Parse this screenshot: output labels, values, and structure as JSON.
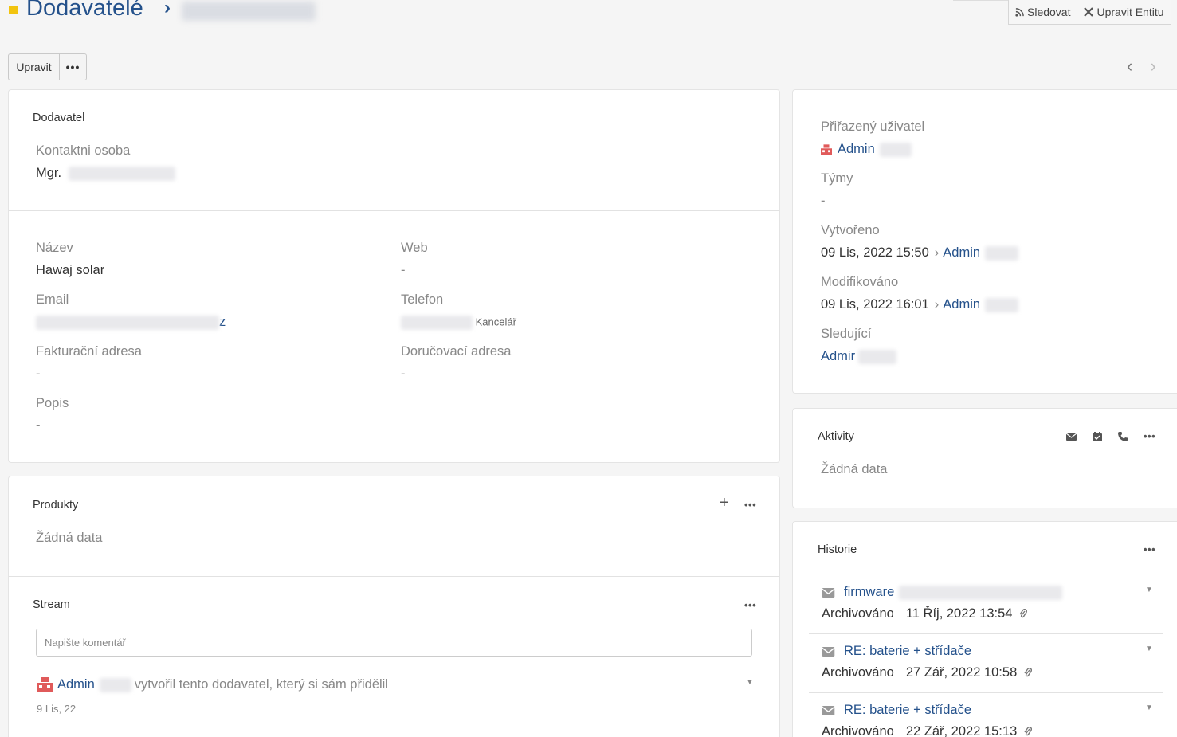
{
  "header": {
    "title": "Dodavatelé",
    "separator": "›",
    "follow_label": "Sledovat",
    "edit_entity_label": "Upravit Entitu"
  },
  "actions": {
    "edit_label": "Upravit",
    "more_label": "•••",
    "prev_label": "‹",
    "next_label": "›"
  },
  "supplier": {
    "title": "Dodavatel",
    "contact_label": "Kontaktni osoba",
    "contact_value": "Mgr.",
    "name_label": "Název",
    "name_value": "Hawaj solar",
    "web_label": "Web",
    "web_value": "-",
    "email_label": "Email",
    "email_suffix": "z",
    "phone_label": "Telefon",
    "phone_type": "Kancelář",
    "billing_label": "Fakturační adresa",
    "billing_value": "-",
    "shipping_label": "Doručovací adresa",
    "shipping_value": "-",
    "desc_label": "Popis",
    "desc_value": "-"
  },
  "products": {
    "title": "Produkty",
    "add_label": "+",
    "more_label": "•••",
    "empty": "Žádná data"
  },
  "stream": {
    "title": "Stream",
    "more_label": "•••",
    "placeholder": "Napište komentář",
    "entry_user": "Admin",
    "entry_text": "vytvořil tento dodavatel, který si sám přidělil",
    "entry_date": "9 Lis, 22"
  },
  "meta": {
    "assigned_label": "Přiřazený uživatel",
    "assigned_value": "Admin",
    "teams_label": "Týmy",
    "teams_value": "-",
    "created_label": "Vytvořeno",
    "created_date": "09 Lis, 2022 15:50",
    "created_by": "Admin",
    "modified_label": "Modifikováno",
    "modified_date": "09 Lis, 2022 16:01",
    "modified_by": "Admin",
    "followers_label": "Sledující",
    "followers_value": "Admir",
    "arrow": "›"
  },
  "activities": {
    "title": "Aktivity",
    "more_label": "•••",
    "empty": "Žádná data"
  },
  "history": {
    "title": "Historie",
    "more_label": "•••",
    "items": [
      {
        "subject": "firmware",
        "status": "Archivováno",
        "date": "11 Říj, 2022 13:54"
      },
      {
        "subject": "RE: baterie + střídače",
        "status": "Archivováno",
        "date": "27 Zář, 2022 10:58"
      },
      {
        "subject": "RE: baterie + střídače",
        "status": "Archivováno",
        "date": "22 Zář, 2022 15:13"
      }
    ]
  },
  "colors": {
    "brand": "#24518b",
    "accent_square": "#f2c40f",
    "user_icon": "#e05a5a"
  }
}
